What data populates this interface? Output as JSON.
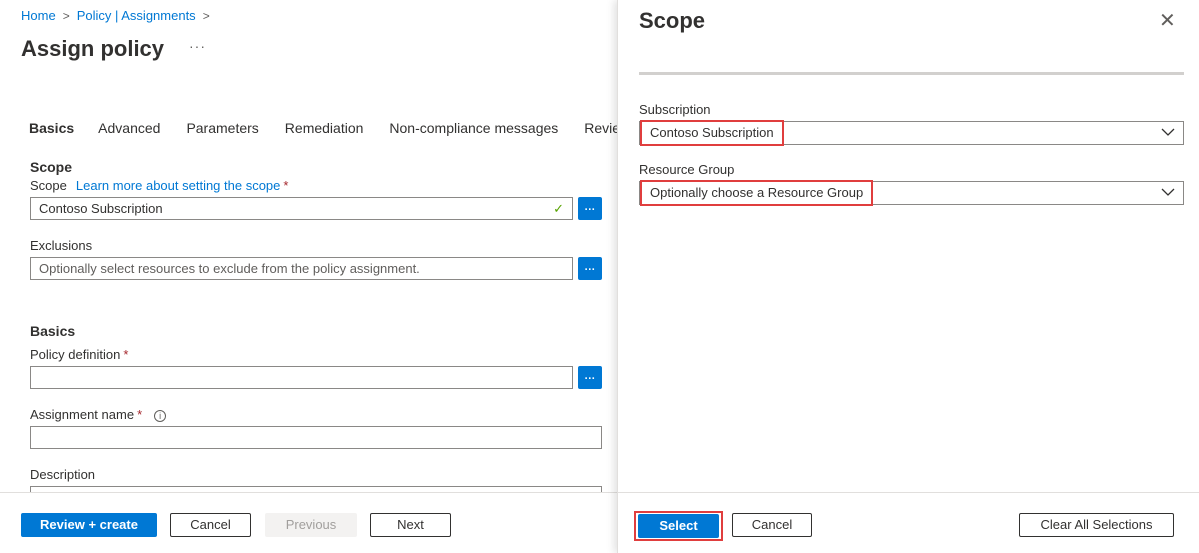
{
  "breadcrumb": {
    "items": [
      "Home",
      "Policy | Assignments"
    ]
  },
  "page": {
    "title": "Assign policy",
    "more": "···"
  },
  "tabs": [
    "Basics",
    "Advanced",
    "Parameters",
    "Remediation",
    "Non-compliance messages",
    "Review"
  ],
  "scope_section": {
    "heading": "Scope",
    "scope_label": "Scope",
    "learn_more": "Learn more about setting the scope",
    "scope_value": "Contoso Subscription",
    "exclusions_label": "Exclusions",
    "exclusions_placeholder": "Optionally select resources to exclude from the policy assignment."
  },
  "basics_section": {
    "heading": "Basics",
    "policy_definition_label": "Policy definition",
    "assignment_name_label": "Assignment name",
    "description_label": "Description"
  },
  "required_marker": "*",
  "browse_label": "...",
  "info_icon_glyph": "i",
  "left_footer": {
    "review_create": "Review + create",
    "cancel": "Cancel",
    "previous": "Previous",
    "next": "Next"
  },
  "scope_panel": {
    "title": "Scope",
    "close_glyph": "✕",
    "subscription_label": "Subscription",
    "subscription_value": "Contoso Subscription",
    "resource_group_label": "Resource Group",
    "resource_group_placeholder": "Optionally choose a Resource Group",
    "select": "Select",
    "cancel": "Cancel",
    "clear_all": "Clear All Selections"
  },
  "colors": {
    "accent": "#0078d4",
    "highlight": "#e03e3e",
    "required": "#a4262c",
    "valid": "#57a300"
  },
  "icons": [
    "chevron-right-icon",
    "more-icon",
    "checkmark-icon",
    "info-icon",
    "close-icon",
    "chevron-down-icon"
  ]
}
